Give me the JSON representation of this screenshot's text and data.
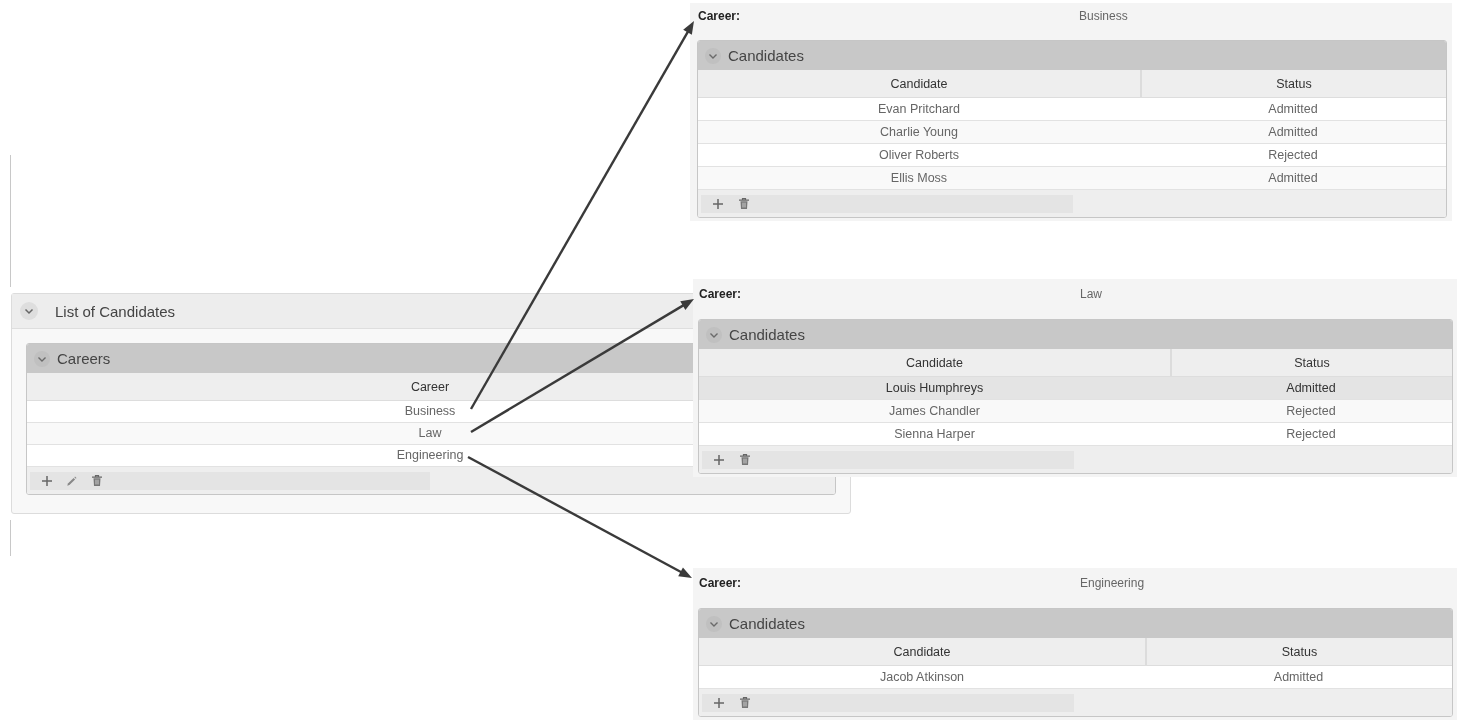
{
  "main_panel": {
    "title": "List of Candidates",
    "expanded": true,
    "careers": {
      "title": "Careers",
      "expanded": true,
      "columns": [
        "Career"
      ],
      "rows": [
        {
          "cells": [
            "Business"
          ],
          "selected": false
        },
        {
          "cells": [
            "Law"
          ],
          "selected": false
        },
        {
          "cells": [
            "Engineering"
          ],
          "selected": false
        }
      ],
      "toolbar": [
        {
          "kind": "add"
        },
        {
          "kind": "edit"
        },
        {
          "kind": "delete"
        }
      ]
    }
  },
  "detail_panels": [
    {
      "label": "Career:",
      "value": "Business",
      "candidates": {
        "title": "Candidates",
        "expanded": true,
        "columns": [
          "Candidate",
          "Status"
        ],
        "rows": [
          {
            "cells": [
              "Evan Pritchard",
              "Admitted"
            ],
            "selected": false
          },
          {
            "cells": [
              "Charlie Young",
              "Admitted"
            ],
            "selected": false
          },
          {
            "cells": [
              "Oliver Roberts",
              "Rejected"
            ],
            "selected": false
          },
          {
            "cells": [
              "Ellis Moss",
              "Admitted"
            ],
            "selected": false
          }
        ],
        "toolbar": [
          {
            "kind": "add"
          },
          {
            "kind": "delete"
          }
        ]
      }
    },
    {
      "label": "Career:",
      "value": "Law",
      "candidates": {
        "title": "Candidates",
        "expanded": true,
        "columns": [
          "Candidate",
          "Status"
        ],
        "rows": [
          {
            "cells": [
              "Louis Humphreys",
              "Admitted"
            ],
            "selected": true
          },
          {
            "cells": [
              "James Chandler",
              "Rejected"
            ],
            "selected": false
          },
          {
            "cells": [
              "Sienna Harper",
              "Rejected"
            ],
            "selected": false
          }
        ],
        "toolbar": [
          {
            "kind": "add"
          },
          {
            "kind": "delete"
          }
        ]
      }
    },
    {
      "label": "Career:",
      "value": "Engineering",
      "candidates": {
        "title": "Candidates",
        "expanded": true,
        "columns": [
          "Candidate",
          "Status"
        ],
        "rows": [
          {
            "cells": [
              "Jacob Atkinson",
              "Admitted"
            ],
            "selected": false
          }
        ],
        "toolbar": [
          {
            "kind": "add"
          },
          {
            "kind": "delete"
          }
        ]
      }
    }
  ]
}
